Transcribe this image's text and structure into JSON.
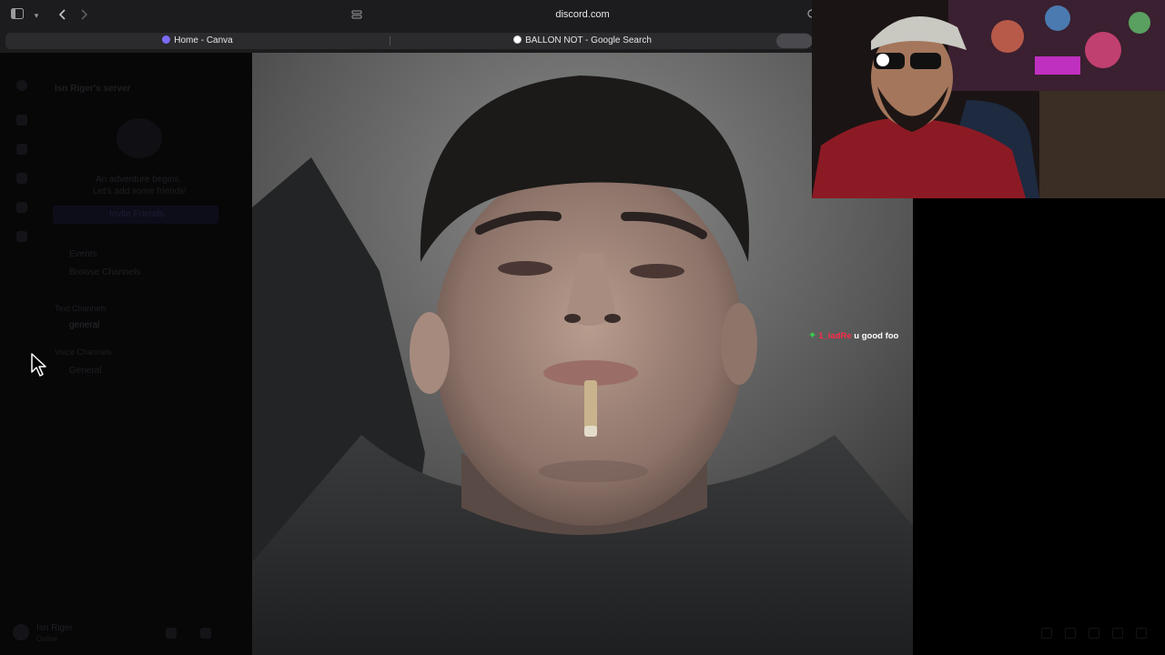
{
  "browser": {
    "address": "discord.com",
    "tabs": [
      {
        "label": "Home - Canva",
        "favicon_color": "#7b6cf6"
      },
      {
        "label": "BALLON NOT - Google Search",
        "favicon_color": "#ffffff"
      }
    ],
    "icons": [
      "sidebar-toggle-icon",
      "chevron-down-icon",
      "back-icon",
      "forward-icon",
      "site-settings-icon",
      "reload-icon"
    ]
  },
  "discord": {
    "server_name": "Isn Riger's server",
    "welcome_line1": "An adventure begins.",
    "welcome_line2": "Let's add some friends!",
    "invite_button": "Invite Friends",
    "events": "Events",
    "browse": "Browse Channels",
    "text_channels_header": "Text Channels",
    "text_channel": "general",
    "voice_channels_header": "Voice Channels",
    "voice_channel": "General",
    "user_name": "Isn Riger",
    "user_status": "Online"
  },
  "chat": {
    "username": "1_ladRe",
    "message": "u good foo",
    "user_color": "#ff2a4a",
    "badge_color": "#36d34a"
  },
  "colors": {
    "toolbar_bg": "#1c1c1e",
    "tabstrip_bg": "#2b2b2e",
    "page_bg": "#000000"
  }
}
